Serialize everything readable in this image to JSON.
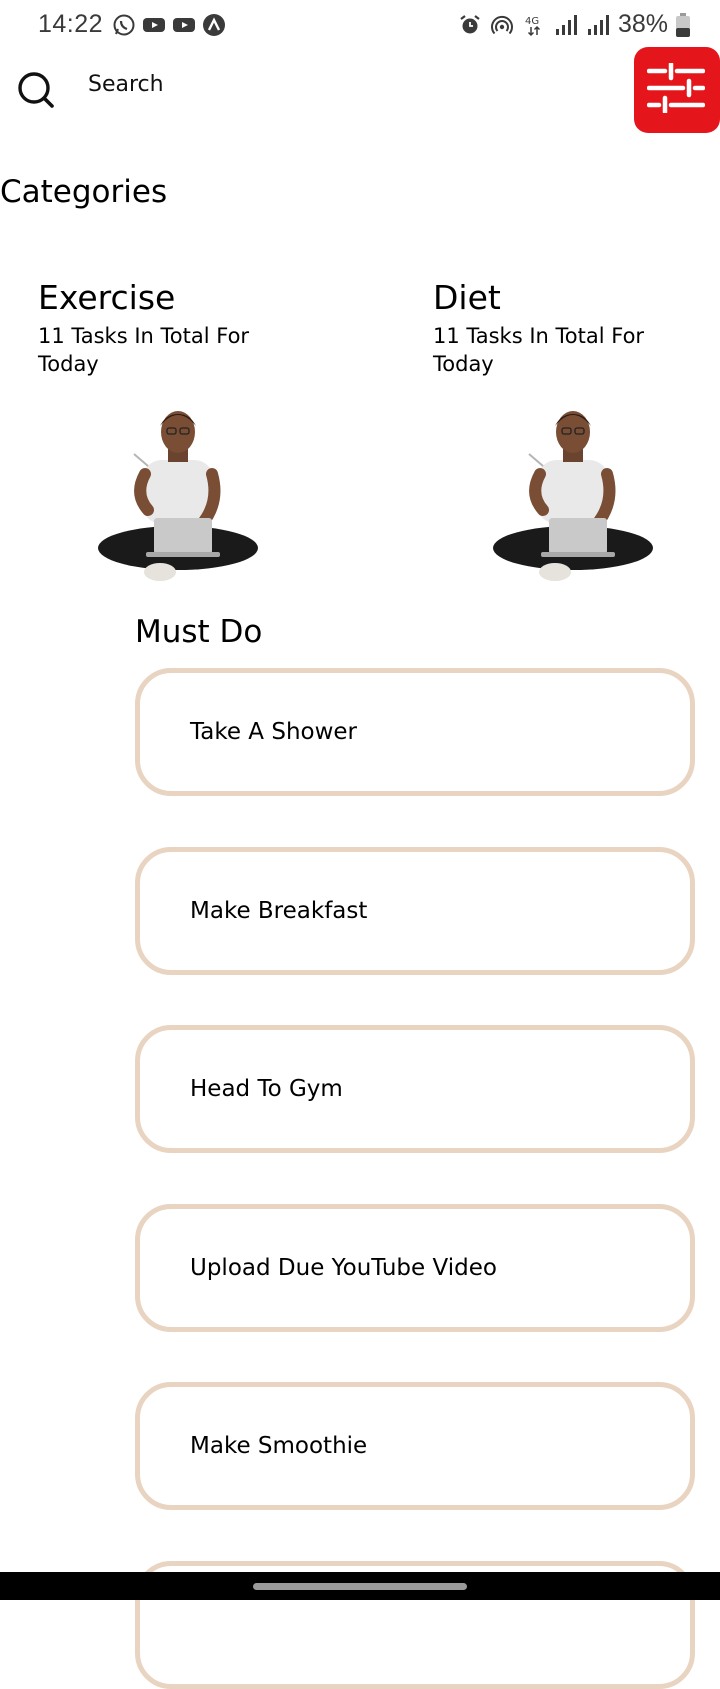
{
  "status_bar": {
    "time": "14:22",
    "battery": "38%",
    "left_icons": [
      "whatsapp-icon",
      "youtube-icon",
      "youtube-icon",
      "app-icon"
    ],
    "right_icons": [
      "alarm-icon",
      "hotspot-icon",
      "4g-icon",
      "signal-icon",
      "signal-icon",
      "battery-icon"
    ]
  },
  "search": {
    "placeholder": "Search",
    "icon": "search-icon"
  },
  "filter_button": {
    "icon": "sliders-icon",
    "color": "#e5161b"
  },
  "categories": {
    "title": "Categories",
    "items": [
      {
        "name": "Exercise",
        "subtitle": "11 Tasks In Total For Today"
      },
      {
        "name": "Diet",
        "subtitle": "11 Tasks In Total For Today"
      }
    ]
  },
  "must_do": {
    "title": "Must Do",
    "border_color": "#e8d4c1",
    "tasks": [
      "Take A Shower",
      "Make Breakfast",
      "Head To Gym",
      "Upload Due YouTube Video",
      "Make Smoothie"
    ]
  }
}
